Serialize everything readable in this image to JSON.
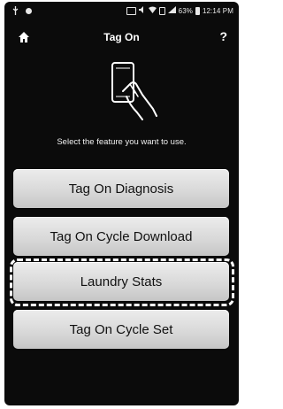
{
  "status_bar": {
    "battery_percent": "63%",
    "time": "12:14 PM",
    "icons": [
      "usb-icon",
      "android-icon",
      "nfc-icon",
      "mute-icon",
      "wifi-icon",
      "sim-icon",
      "signal-icon",
      "battery-icon"
    ]
  },
  "header": {
    "title": "Tag On",
    "help_label": "?"
  },
  "main": {
    "prompt": "Select the feature you want to use.",
    "buttons": [
      {
        "label": "Tag On Diagnosis"
      },
      {
        "label": "Tag On Cycle Download"
      },
      {
        "label": "Laundry Stats",
        "focused": true
      },
      {
        "label": "Tag On Cycle Set"
      }
    ]
  },
  "colors": {
    "screen_background": "#0b0b0b",
    "button_background": "#d9d9d9",
    "button_text": "#111111",
    "focus_ring": "#ffffff"
  }
}
